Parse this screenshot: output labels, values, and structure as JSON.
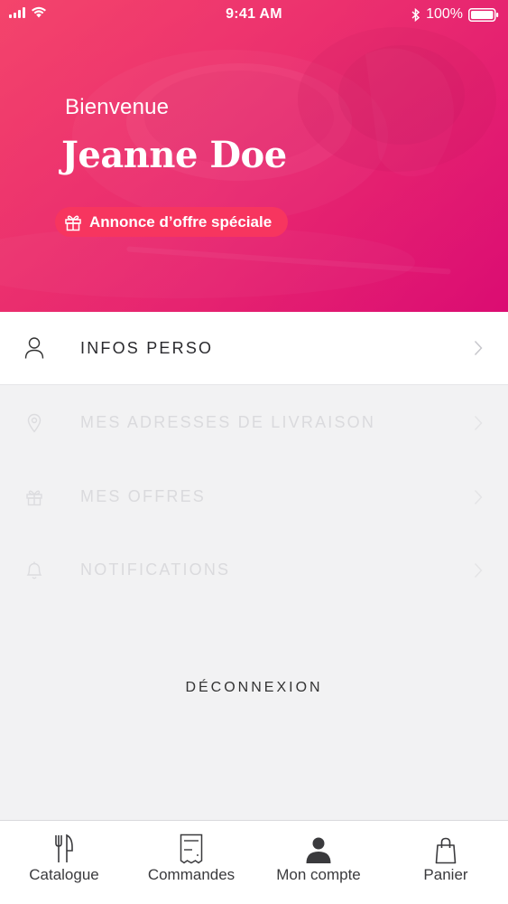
{
  "status_bar": {
    "time": "9:41 AM",
    "battery": "100%",
    "icons": [
      "signal-icon",
      "wifi-icon",
      "bluetooth-icon",
      "battery-icon"
    ]
  },
  "header": {
    "greeting": "Bienvenue",
    "user_name": "Jeanne Doe",
    "promo_label": "Annonce d’offre spéciale",
    "promo_icon": "gift-icon",
    "gradient_start": "#f23f6a",
    "gradient_end": "#df0f73"
  },
  "menu": {
    "items": [
      {
        "label": "INFOS PERSO",
        "icon": "user-icon",
        "active": true
      },
      {
        "label": "MES ADRESSES DE LIVRAISON",
        "icon": "location-pin-icon",
        "active": false
      },
      {
        "label": "MES OFFRES",
        "icon": "gift-icon",
        "active": false
      },
      {
        "label": "NOTIFICATIONS",
        "icon": "bell-icon",
        "active": false
      }
    ],
    "logout_label": "DÉCONNEXION"
  },
  "tab_bar": {
    "tabs": [
      {
        "label": "Catalogue",
        "icon": "fork-knife-icon"
      },
      {
        "label": "Commandes",
        "icon": "receipt-icon"
      },
      {
        "label": "Mon compte",
        "icon": "person-icon",
        "selected": true
      },
      {
        "label": "Panier",
        "icon": "shopping-bag-icon"
      }
    ]
  }
}
